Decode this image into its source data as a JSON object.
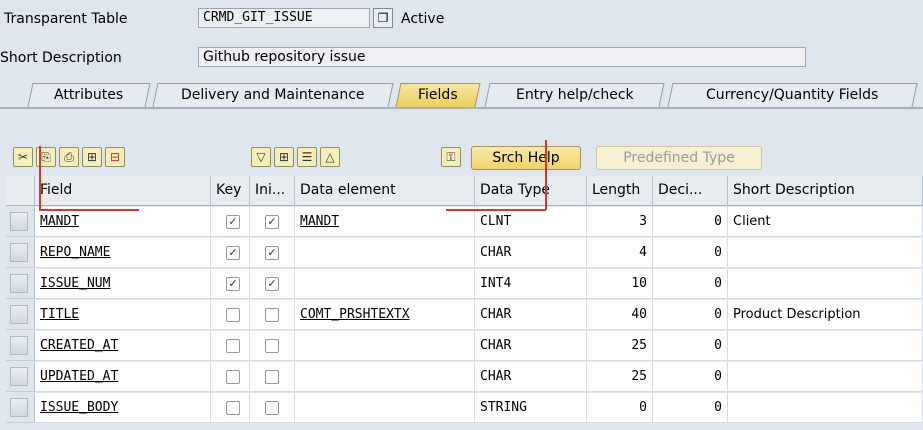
{
  "header": {
    "table_type_label": "Transparent Table",
    "table_name": "CRMD_GIT_ISSUE",
    "status": "Active",
    "short_desc_label": "Short Description",
    "short_desc_value": "Github repository issue"
  },
  "tabs": [
    {
      "label": "Attributes",
      "active": false
    },
    {
      "label": "Delivery and Maintenance",
      "active": false
    },
    {
      "label": "Fields",
      "active": true
    },
    {
      "label": "Entry help/check",
      "active": false
    },
    {
      "label": "Currency/Quantity Fields",
      "active": false
    }
  ],
  "toolbar": {
    "srch_help_label": "Srch Help",
    "predefined_type_label": "Predefined Type",
    "icons": [
      "cut-icon",
      "copy-icon",
      "paste-icon",
      "insert-row-icon",
      "delete-row-icon",
      "filter-icon",
      "insert-icon",
      "details-icon",
      "collapse-icon",
      "key-search-icon"
    ]
  },
  "table": {
    "columns": [
      "Field",
      "Key",
      "Ini...",
      "Data element",
      "Data Type",
      "Length",
      "Deci...",
      "Short Description"
    ],
    "rows": [
      {
        "field": "MANDT",
        "key": true,
        "ini": true,
        "data_element": "MANDT",
        "data_type": "CLNT",
        "length": "3",
        "decimals": "0",
        "short_desc": "Client"
      },
      {
        "field": "REPO_NAME",
        "key": true,
        "ini": true,
        "data_element": "",
        "data_type": "CHAR",
        "length": "4",
        "decimals": "0",
        "short_desc": ""
      },
      {
        "field": "ISSUE_NUM",
        "key": true,
        "ini": true,
        "data_element": "",
        "data_type": "INT4",
        "length": "10",
        "decimals": "0",
        "short_desc": ""
      },
      {
        "field": "TITLE",
        "key": false,
        "ini": false,
        "data_element": "COMT_PRSHTEXTX",
        "data_type": "CHAR",
        "length": "40",
        "decimals": "0",
        "short_desc": "Product Description"
      },
      {
        "field": "CREATED_AT",
        "key": false,
        "ini": false,
        "data_element": "",
        "data_type": "CHAR",
        "length": "25",
        "decimals": "0",
        "short_desc": ""
      },
      {
        "field": "UPDATED_AT",
        "key": false,
        "ini": false,
        "data_element": "",
        "data_type": "CHAR",
        "length": "25",
        "decimals": "0",
        "short_desc": ""
      },
      {
        "field": "ISSUE_BODY",
        "key": false,
        "ini": false,
        "data_element": "",
        "data_type": "STRING",
        "length": "0",
        "decimals": "0",
        "short_desc": ""
      }
    ]
  },
  "colors": {
    "annotation_red": "#d9362b",
    "active_tab": "#eccf5a"
  }
}
